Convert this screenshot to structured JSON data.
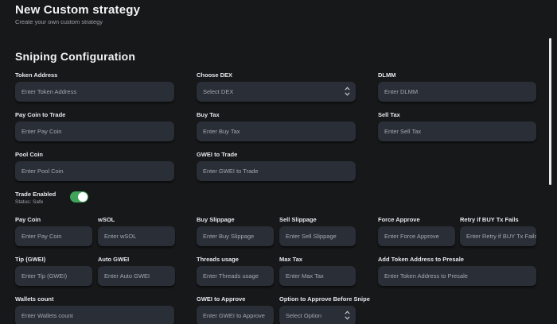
{
  "header": {
    "title": "New Custom strategy",
    "subtitle": "Create your own custom strategy"
  },
  "section": {
    "title": "Sniping Configuration"
  },
  "fields": {
    "token_address": {
      "label": "Token Address",
      "placeholder": "Enter Token Address"
    },
    "choose_dex": {
      "label": "Choose DEX",
      "selected": "Select DEX"
    },
    "dlmm": {
      "label": "DLMM",
      "placeholder": "Enter DLMM"
    },
    "pay_coin_to_trade": {
      "label": "Pay Coin to Trade",
      "placeholder": "Enter Pay Coin"
    },
    "buy_tax": {
      "label": "Buy Tax",
      "placeholder": "Enter Buy Tax"
    },
    "sell_tax": {
      "label": "Sell Tax",
      "placeholder": "Enter Sell Tax"
    },
    "pool_coin": {
      "label": "Pool Coin",
      "placeholder": "Enter Pool Coin"
    },
    "gwei_to_trade": {
      "label": "GWEI to Trade",
      "placeholder": "Enter GWEI to Trade"
    },
    "pay_coin": {
      "label": "Pay Coin",
      "placeholder": "Enter Pay Coin"
    },
    "wsol": {
      "label": "wSOL",
      "placeholder": "Enter wSOL"
    },
    "buy_slippage": {
      "label": "Buy Slippage",
      "placeholder": "Enter Buy Slippage"
    },
    "sell_slippage": {
      "label": "Sell Slippage",
      "placeholder": "Enter Sell Slippage"
    },
    "force_approve": {
      "label": "Force Approve",
      "placeholder": "Enter Force Approve"
    },
    "retry_buy": {
      "label": "Retry if BUY Tx Fails",
      "placeholder": "Enter Retry if BUY Tx Fails"
    },
    "tip_gwei": {
      "label": "Tip (GWEI)",
      "placeholder": "Enter Tip (GWEI)"
    },
    "auto_gwei": {
      "label": "Auto GWEI",
      "placeholder": "Enter Auto GWEI"
    },
    "threads_usage": {
      "label": "Threads usage",
      "placeholder": "Enter Threads usage"
    },
    "max_tax": {
      "label": "Max Tax",
      "placeholder": "Enter Max Tax"
    },
    "presale_address": {
      "label": "Add Token Address to Presale",
      "placeholder": "Enter Token Address to Presale"
    },
    "wallets_count": {
      "label": "Wallets count",
      "placeholder": "Enter Wallets count"
    },
    "gwei_to_approve": {
      "label": "GWEI to Approve",
      "placeholder": "Enter GWEI to Approve"
    },
    "approve_option": {
      "label": "Option to Approve Before Snipe",
      "selected": "Select Option"
    }
  },
  "trade_enabled": {
    "label": "Trade Enabled",
    "status": "Status: Safe",
    "on": true,
    "color_on": "#3fa45a"
  }
}
